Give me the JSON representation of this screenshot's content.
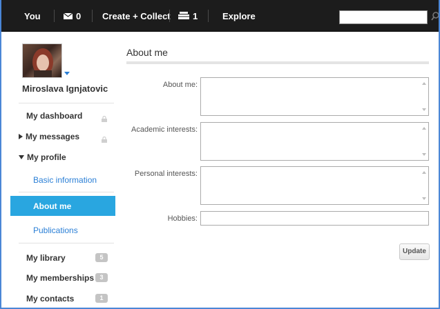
{
  "topbar": {
    "you_label": "You",
    "messages_count": "0",
    "create_collect_label": "Create + Collect",
    "basket_count": "1",
    "explore_label": "Explore",
    "search_placeholder": ""
  },
  "user": {
    "name": "Miroslava Ignjatovic"
  },
  "sidebar": {
    "dashboard": "My dashboard",
    "messages": "My messages",
    "profile": "My profile",
    "basic_info": "Basic information",
    "about_me": "About me",
    "publications": "Publications",
    "library": "My library",
    "library_count": "5",
    "memberships": "My memberships",
    "memberships_count": "3",
    "contacts": "My contacts",
    "contacts_count": "1"
  },
  "main": {
    "title": "About me",
    "fields": {
      "about_me_label": "About me:",
      "about_me_value": "",
      "academic_label": "Academic interests:",
      "academic_value": "",
      "personal_label": "Personal interests:",
      "personal_value": "",
      "hobbies_label": "Hobbies:",
      "hobbies_value": ""
    },
    "update_label": "Update"
  },
  "colors": {
    "topbar_bg": "#1c1c1c",
    "accent_active": "#29a6e0",
    "link_blue": "#2a7fd6",
    "frame_blue": "#4a86d6"
  },
  "icons": {
    "messages": "envelope-icon",
    "basket": "basket-icon",
    "search": "search-icon",
    "lock": "lock-icon"
  }
}
